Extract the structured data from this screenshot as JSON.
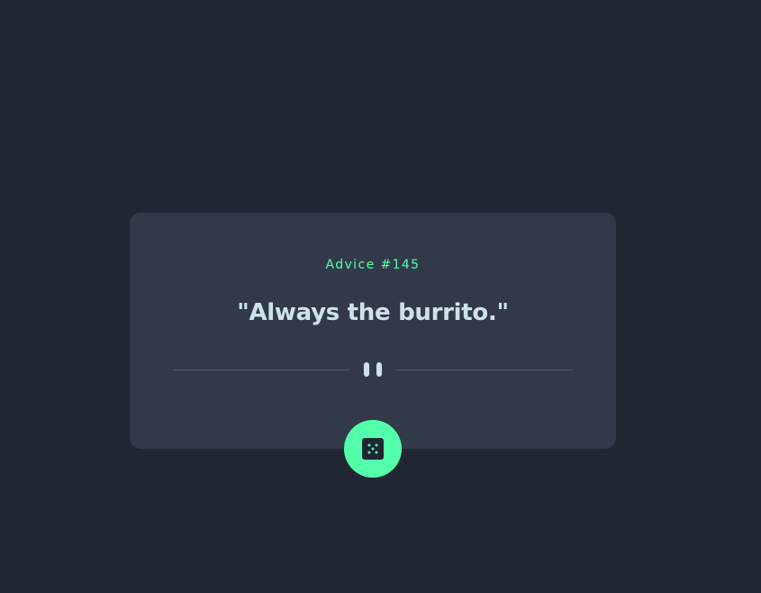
{
  "advice": {
    "label": "Advice #145",
    "quote": "\"Always the burrito.\""
  },
  "icons": {
    "divider": "pause-icon",
    "button": "dice-icon"
  },
  "colors": {
    "background": "#202632",
    "card": "#323a49",
    "accent": "#53ffaa",
    "text": "#cee3e9",
    "divider_line": "#4f5d74"
  }
}
